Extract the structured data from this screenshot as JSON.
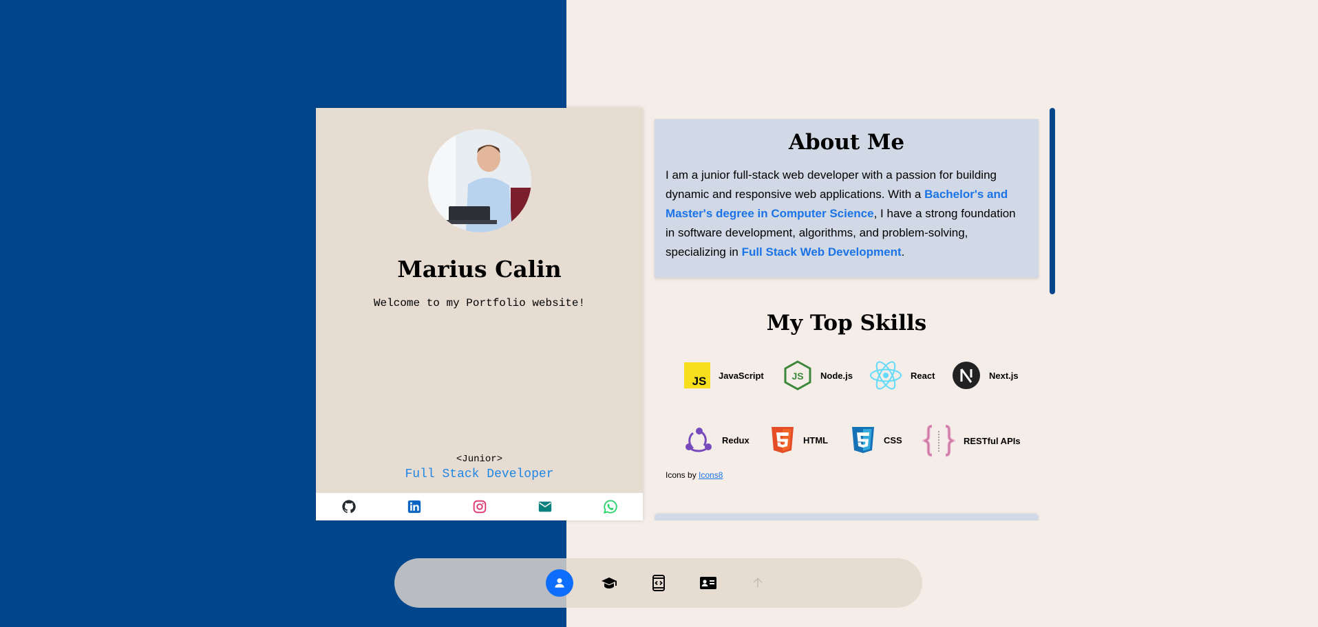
{
  "profile": {
    "name": "Marius Calin",
    "welcome": "Welcome to my Portfolio website!",
    "level": "<Junior>",
    "role": "Full Stack Developer",
    "social": [
      "github-icon",
      "linkedin-icon",
      "instagram-icon",
      "email-icon",
      "whatsapp-icon"
    ]
  },
  "about": {
    "title": "About Me",
    "text_1": "I am a junior full-stack web developer with a passion for building dynamic and responsive web applications. With a ",
    "highlight_1": "Bachelor's and Master's degree in Computer Science",
    "text_2": ", I have a strong foundation in software development, algorithms, and problem-solving, specializing in ",
    "highlight_2": "Full Stack Web Development",
    "text_3": "."
  },
  "skills": {
    "title": "My Top Skills",
    "items": [
      {
        "label": "JavaScript",
        "icon": "javascript-icon"
      },
      {
        "label": "Node.js",
        "icon": "nodejs-icon"
      },
      {
        "label": "React",
        "icon": "react-icon"
      },
      {
        "label": "Next.js",
        "icon": "nextjs-icon"
      },
      {
        "label": "Redux",
        "icon": "redux-icon"
      },
      {
        "label": "HTML",
        "icon": "html5-icon"
      },
      {
        "label": "CSS",
        "icon": "css3-icon"
      },
      {
        "label": "RESTful APIs",
        "icon": "restful-api-icon"
      }
    ],
    "credit_prefix": "Icons by ",
    "credit_link": "Icons8"
  },
  "nav": {
    "items": [
      "profile-icon",
      "education-icon",
      "projects-icon",
      "contact-card-icon",
      "arrow-up-icon"
    ],
    "active": "profile-icon"
  },
  "colors": {
    "brand_blue": "#00468d",
    "accent": "#1a73e8",
    "cream": "#f5ede8",
    "card": "#e6dcd1",
    "about_bg": "#d1d9e6"
  }
}
